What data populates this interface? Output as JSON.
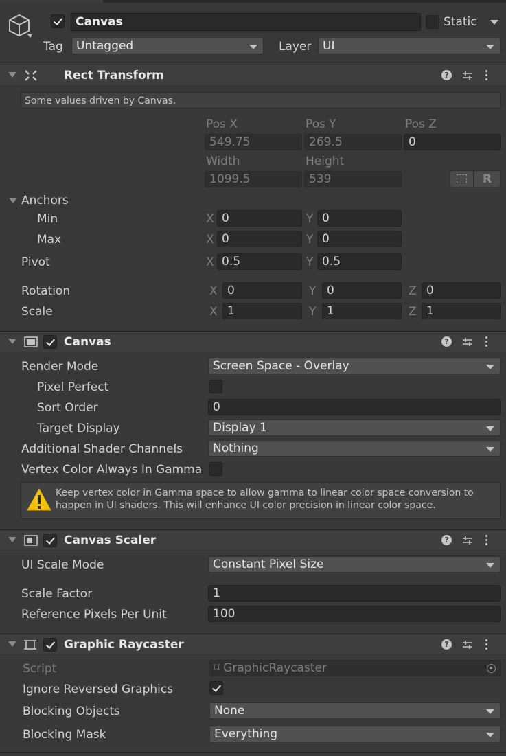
{
  "object": {
    "name": "Canvas",
    "static_label": "Static",
    "tag_label": "Tag",
    "tag_value": "Untagged",
    "layer_label": "Layer",
    "layer_value": "UI"
  },
  "rect_transform": {
    "title": "Rect Transform",
    "driven_note": "Some values driven by Canvas.",
    "pos_x_label": "Pos X",
    "pos_y_label": "Pos Y",
    "pos_z_label": "Pos Z",
    "pos_x": "549.75",
    "pos_y": "269.5",
    "pos_z": "0",
    "width_label": "Width",
    "height_label": "Height",
    "width": "1099.5",
    "height": "539",
    "raw_button": "R",
    "anchors_label": "Anchors",
    "min_label": "Min",
    "max_label": "Max",
    "anchor_min_x": "0",
    "anchor_min_y": "0",
    "anchor_max_x": "0",
    "anchor_max_y": "0",
    "pivot_label": "Pivot",
    "pivot_x": "0.5",
    "pivot_y": "0.5",
    "rotation_label": "Rotation",
    "rot_x": "0",
    "rot_y": "0",
    "rot_z": "0",
    "scale_label": "Scale",
    "scale_x": "1",
    "scale_y": "1",
    "scale_z": "1",
    "x": "X",
    "y": "Y",
    "z": "Z"
  },
  "canvas": {
    "title": "Canvas",
    "render_mode_label": "Render Mode",
    "render_mode": "Screen Space - Overlay",
    "pixel_perfect_label": "Pixel Perfect",
    "sort_order_label": "Sort Order",
    "sort_order": "0",
    "target_display_label": "Target Display",
    "target_display": "Display 1",
    "shader_channels_label": "Additional Shader Channels",
    "shader_channels": "Nothing",
    "vertex_color_label": "Vertex Color Always In Gamma",
    "warning_line1": "Keep vertex color in Gamma space to allow gamma to linear color space conversion to",
    "warning_line2": "happen in UI shaders. This will enhance UI color precision in linear color space."
  },
  "canvas_scaler": {
    "title": "Canvas Scaler",
    "scale_mode_label": "UI Scale Mode",
    "scale_mode": "Constant Pixel Size",
    "scale_factor_label": "Scale Factor",
    "scale_factor": "1",
    "ref_ppu_label": "Reference Pixels Per Unit",
    "ref_ppu": "100"
  },
  "graphic_raycaster": {
    "title": "Graphic Raycaster",
    "script_label": "Script",
    "script": "GraphicRaycaster",
    "ignore_reversed_label": "Ignore Reversed Graphics",
    "blocking_objects_label": "Blocking Objects",
    "blocking_objects": "None",
    "blocking_mask_label": "Blocking Mask",
    "blocking_mask": "Everything"
  }
}
